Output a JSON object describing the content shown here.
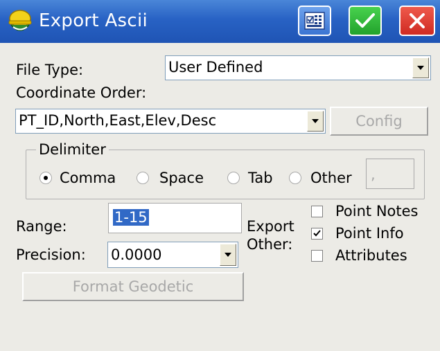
{
  "window": {
    "title": "Export Ascii",
    "title_bar_color": "#2a64c6",
    "buttons": [
      "keyboard",
      "ok",
      "close"
    ]
  },
  "form": {
    "file_type": {
      "label": "File Type:",
      "value": "User Defined"
    },
    "coordinate_order": {
      "label": "Coordinate Order:",
      "value": "PT_ID,North,East,Elev,Desc"
    },
    "config_button": "Config",
    "range": {
      "label": "Range:",
      "value": "1-15"
    },
    "precision": {
      "label": "Precision:",
      "value": "0.0000"
    },
    "format_geodetic_button": "Format Geodetic"
  },
  "delimiter": {
    "title": "Delimiter",
    "options": [
      "Comma",
      "Space",
      "Tab",
      "Other"
    ],
    "selected": "Comma",
    "other_value": ","
  },
  "export_other": {
    "label_line1": "Export",
    "label_line2": "Other:",
    "options": [
      {
        "label": "Point Notes",
        "checked": false
      },
      {
        "label": "Point Info",
        "checked": true
      },
      {
        "label": "Attributes",
        "checked": false
      }
    ]
  },
  "colors": {
    "background": "#ecebe6",
    "selection": "#3169c6",
    "ok_button": "#2cb236",
    "close_button": "#d9352b",
    "disabled_text": "#a8a8a8"
  }
}
